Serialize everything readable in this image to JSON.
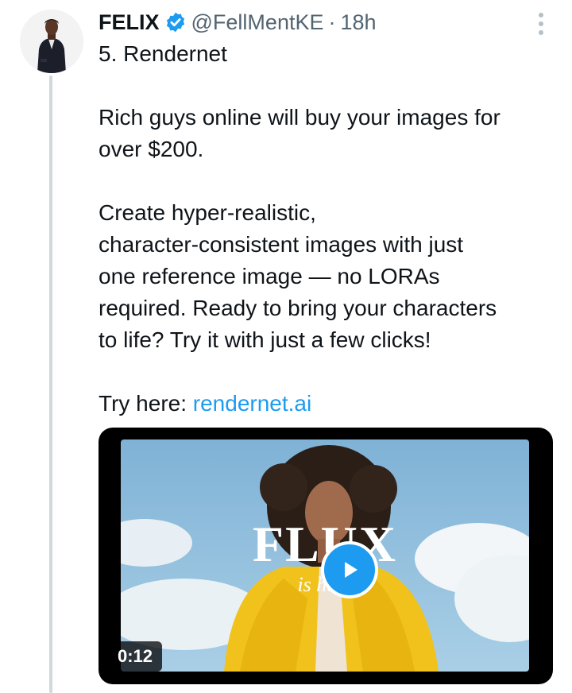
{
  "post": {
    "author_name": "FELIX",
    "handle": "@FellMentKE",
    "separator": "·",
    "time_ago": "18h",
    "body_lines": [
      "5. Rendernet",
      "Rich guys online will buy your images for",
      "over $200.",
      "Create hyper-realistic,",
      "character-consistent images with just",
      "one reference image — no LORAs",
      "required. Ready to bring your characters",
      "to life? Try it with just a few clicks!"
    ],
    "try_label": "Try here: ",
    "link_text": "rendernet.ai"
  },
  "media": {
    "type": "video",
    "duration": "0:12",
    "overlay_title": "FLUX",
    "overlay_subtitle": "is here"
  },
  "colors": {
    "link": "#1d9bf0",
    "verified_badge": "#1d9bf0",
    "secondary_text": "#536471",
    "thread_line": "#cfd9de"
  },
  "icons": [
    "verified-badge-icon",
    "more-options-icon",
    "play-icon"
  ]
}
